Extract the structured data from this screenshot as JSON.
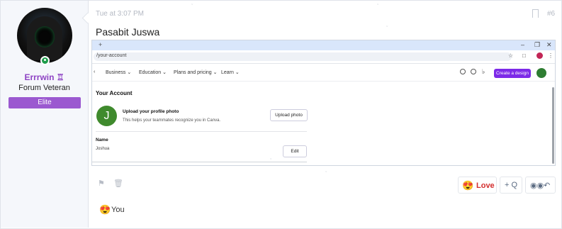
{
  "author": {
    "username": "Errrwin",
    "rank": "Forum Veteran",
    "badge": "Elite",
    "online_status": "online"
  },
  "post": {
    "timestamp": "Tue at 3:07 PM",
    "number": "#6",
    "title": "Pasabit Juswa"
  },
  "screenshot": {
    "url": "/your-account",
    "nav_items": [
      "Business",
      "Education",
      "Plans and pricing",
      "Learn"
    ],
    "create_button": "Create a design",
    "account_title": "Your Account",
    "avatar_letter": "J",
    "upload_title": "Upload your profile photo",
    "upload_desc": "This helps your teammates recognize you in Canva.",
    "upload_button": "Upload photo",
    "name_label": "Name",
    "name_value": "Joshua",
    "edit_button": "Edit",
    "window_controls": [
      "–",
      "❐",
      "✕"
    ]
  },
  "actions": {
    "love_label": "Love",
    "quote_label": "+ Q"
  },
  "reactions": {
    "summary": "You"
  },
  "colors": {
    "username": "#8e44c4",
    "badge_bg": "#9b59d0",
    "love": "#d32f2f",
    "create_button_bg": "#7d2ae8"
  }
}
